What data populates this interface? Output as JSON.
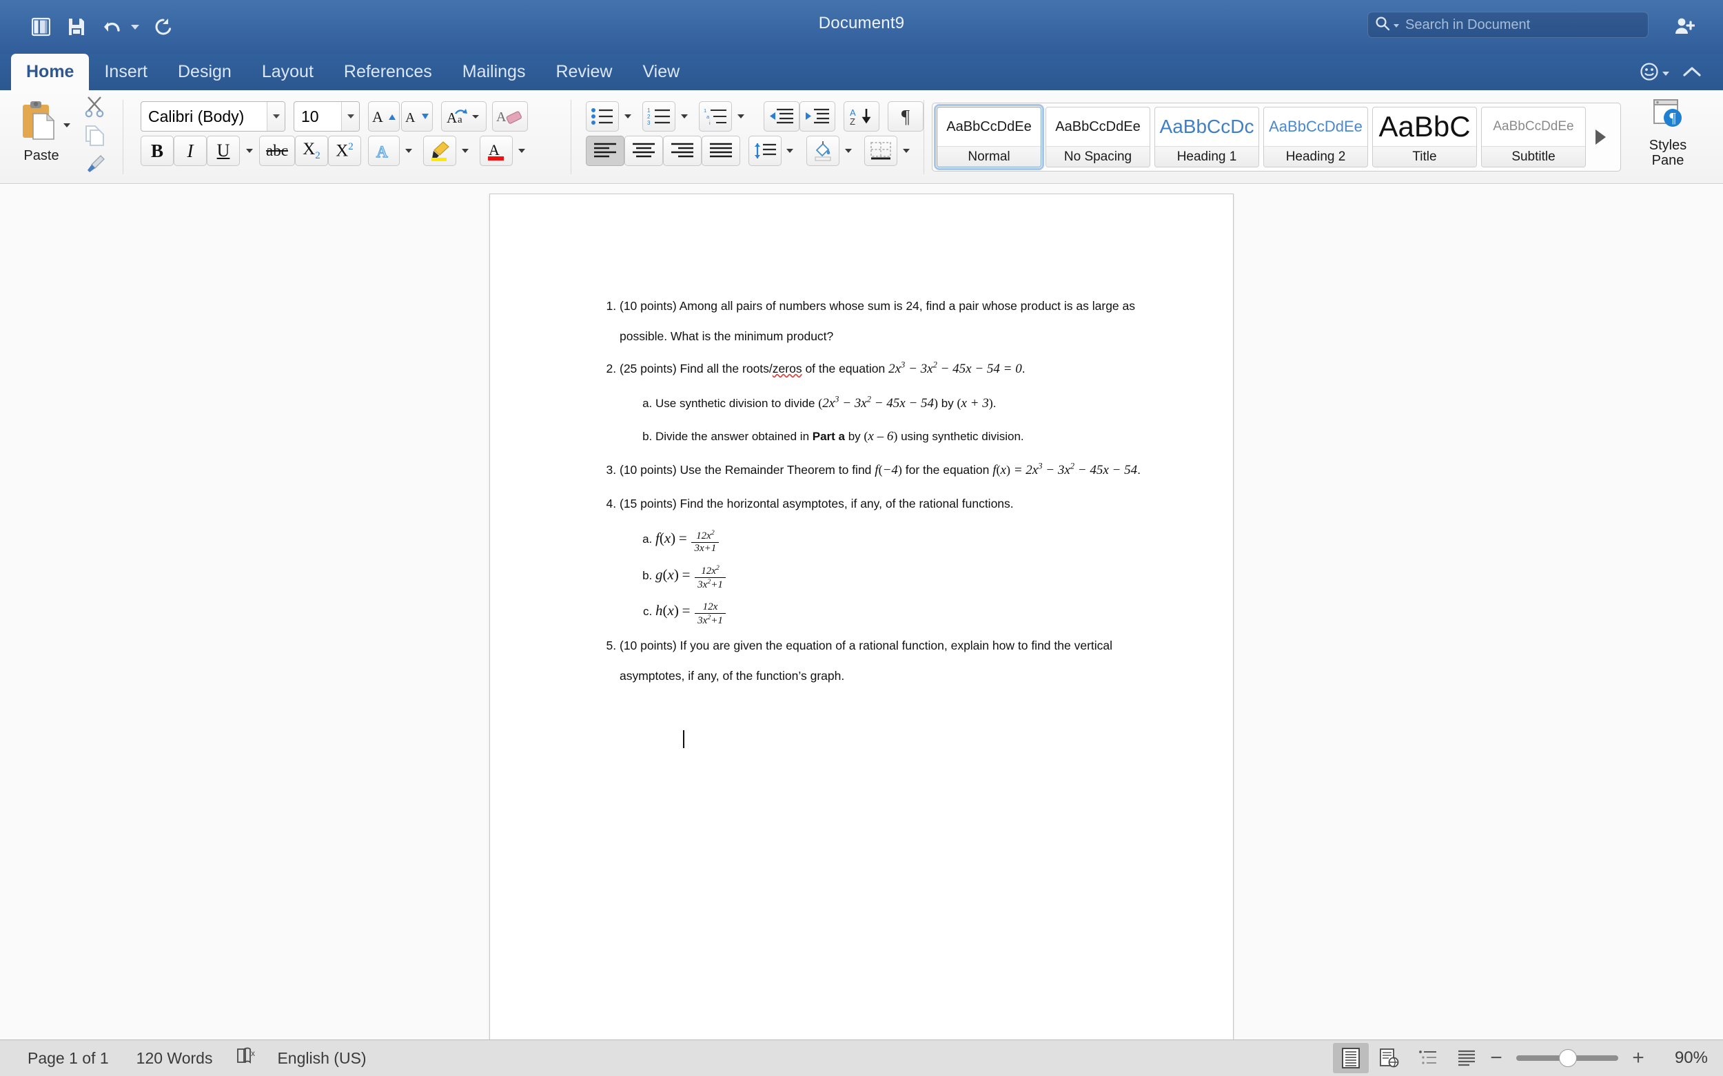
{
  "titlebar": {
    "document_title": "Document9",
    "quick_access": [
      {
        "name": "sidebar-toggle",
        "icon": "sidebar-icon"
      },
      {
        "name": "save",
        "icon": "save-icon"
      },
      {
        "name": "undo",
        "icon": "undo-icon"
      },
      {
        "name": "redo",
        "icon": "redo-icon"
      }
    ],
    "search": {
      "placeholder": "Search in Document",
      "value": ""
    },
    "share_icon": "add-person-icon"
  },
  "tabs": [
    {
      "label": "Home",
      "active": true
    },
    {
      "label": "Insert",
      "active": false
    },
    {
      "label": "Design",
      "active": false
    },
    {
      "label": "Layout",
      "active": false
    },
    {
      "label": "References",
      "active": false
    },
    {
      "label": "Mailings",
      "active": false
    },
    {
      "label": "Review",
      "active": false
    },
    {
      "label": "View",
      "active": false
    }
  ],
  "ribbon": {
    "clipboard": {
      "paste_label": "Paste"
    },
    "font": {
      "font_name": "Calibri (Body)",
      "font_size": "10"
    },
    "styles": {
      "items": [
        {
          "preview": "AaBbCcDdEe",
          "name": "Normal",
          "selected": true
        },
        {
          "preview": "AaBbCcDdEe",
          "name": "No Spacing",
          "selected": false
        },
        {
          "preview": "AaBbCcDc",
          "name": "Heading 1",
          "selected": false
        },
        {
          "preview": "AaBbCcDdEe",
          "name": "Heading 2",
          "selected": false
        },
        {
          "preview": "AaBbC",
          "name": "Title",
          "selected": false
        },
        {
          "preview": "AaBbCcDdEe",
          "name": "Subtitle",
          "selected": false
        }
      ],
      "pane_label_line1": "Styles",
      "pane_label_line2": "Pane"
    }
  },
  "document": {
    "items": [
      {
        "number": "1.",
        "text_html": "(10 points) Among all pairs of numbers whose sum is 24, find a pair whose product is as large as possible. What is the minimum product?"
      },
      {
        "number": "2.",
        "text_html": "(25 points) Find all the roots/<span class=\"sp-err\">zeros</span> of the equation <span class=\"m\">2x<sup class=\"e\">3</sup> &#8722; 3x<sup class=\"e\">2</sup> &#8722; 45x &#8722; 54 = 0</span>.",
        "sub": [
          {
            "letter": "a.",
            "text_html": "Use synthetic division to divide <span class=\"mn\">(</span><span class=\"m\">2x<sup class=\"e\">3</sup> &#8722; 3x<sup class=\"e\">2</sup> &#8722; 45x &#8722; 54</span><span class=\"mn\">)</span> by <span class=\"mn\">(</span><span class=\"m\">x + 3</span><span class=\"mn\">)</span>."
          },
          {
            "letter": "b.",
            "text_html": "Divide the answer obtained in <b>Part a</b> by <span class=\"mn\">(</span><span class=\"m\">x &#8211; 6</span><span class=\"mn\">)</span> using synthetic division."
          }
        ]
      },
      {
        "number": "3.",
        "text_html": "(10 points) Use the Remainder Theorem to find <span class=\"m\">f</span><span class=\"mn\">(</span><span class=\"m\">&#8722;4</span><span class=\"mn\">)</span> for the equation <span class=\"m\">f</span><span class=\"mn\">(</span><span class=\"m\">x</span><span class=\"mn\">)</span><span class=\"m\"> = 2x<sup class=\"e\">3</sup> &#8722; 3x<sup class=\"e\">2</sup> &#8722; 45x &#8722; 54</span>."
      },
      {
        "number": "4.",
        "text_html": "(15 points) Find the horizontal asymptotes, if any, of the rational functions.",
        "sub": [
          {
            "letter": "a.",
            "text_html": "<span class=\"m\" style=\"font-size:21px\">f</span><span class=\"mn\" style=\"font-size:21px\">(</span><span class=\"m\" style=\"font-size:21px\">x</span><span class=\"mn\" style=\"font-size:21px\">)</span> <span class=\"mn\" style=\"font-size:21px\">=</span> <span class=\"frac\"><span class=\"n\">12x<sup class=\"e\">2</sup></span><span class=\"d\">3x+1</span></span>"
          },
          {
            "letter": "b.",
            "text_html": "<span class=\"m\" style=\"font-size:21px\">g</span><span class=\"mn\" style=\"font-size:21px\">(</span><span class=\"m\" style=\"font-size:21px\">x</span><span class=\"mn\" style=\"font-size:21px\">)</span> <span class=\"mn\" style=\"font-size:21px\">=</span> <span class=\"frac\"><span class=\"n\">12x<sup class=\"e\">2</sup></span><span class=\"d\">3x<sup class=\"e\">2</sup>+1</span></span>"
          },
          {
            "letter": "c.",
            "text_html": "<span class=\"m\" style=\"font-size:21px\">h</span><span class=\"mn\" style=\"font-size:21px\">(</span><span class=\"m\" style=\"font-size:21px\">x</span><span class=\"mn\" style=\"font-size:21px\">)</span> <span class=\"mn\" style=\"font-size:21px\">=</span> <span class=\"frac\"><span class=\"n\">12x</span><span class=\"d\">3x<sup class=\"e\">2</sup>+1</span></span>"
          }
        ]
      },
      {
        "number": "5.",
        "text_html": "(10 points) If you are given the equation of a rational function, explain how to find the vertical asymptotes, if any, of the function&#8217;s graph."
      }
    ]
  },
  "status": {
    "page": "Page 1 of 1",
    "words": "120 Words",
    "proofing_icon": "spellcheck-icon",
    "language": "English (US)",
    "zoom_value": "90%",
    "zoom_percent": 90,
    "views": [
      {
        "name": "print-layout",
        "active": true
      },
      {
        "name": "web-layout",
        "active": false
      },
      {
        "name": "outline",
        "active": false
      },
      {
        "name": "draft",
        "active": false
      }
    ]
  },
  "colors": {
    "titlebar_blue": "#3a68a4",
    "tabstrip_blue": "#2c5791",
    "accent_blue": "#1f6fc4",
    "highlight_yellow": "#ffe900",
    "font_color_red": "#ee1111",
    "spellcheck_red": "#d6453c"
  }
}
